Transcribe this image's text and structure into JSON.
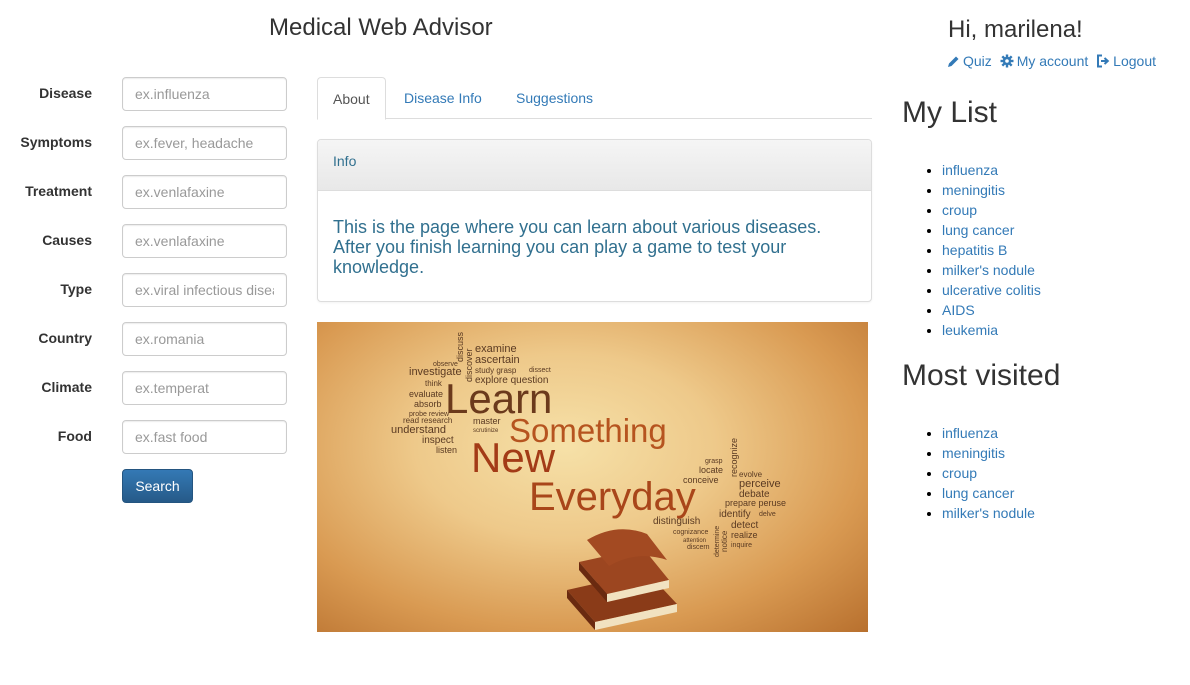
{
  "header": {
    "title": "Medical Web Advisor"
  },
  "user": {
    "greeting": "Hi, marilena!",
    "links": {
      "quiz": "Quiz",
      "account": "My account",
      "logout": "Logout"
    }
  },
  "search_form": {
    "fields": [
      {
        "label": "Disease",
        "placeholder": "ex.influenza"
      },
      {
        "label": "Symptoms",
        "placeholder": "ex.fever, headache"
      },
      {
        "label": "Treatment",
        "placeholder": "ex.venlafaxine"
      },
      {
        "label": "Causes",
        "placeholder": "ex.venlafaxine"
      },
      {
        "label": "Type",
        "placeholder": "ex.viral infectious disease"
      },
      {
        "label": "Country",
        "placeholder": "ex.romania"
      },
      {
        "label": "Climate",
        "placeholder": "ex.temperat"
      },
      {
        "label": "Food",
        "placeholder": "ex.fast food"
      }
    ],
    "submit_label": "Search"
  },
  "tabs": [
    {
      "label": "About",
      "active": true
    },
    {
      "label": "Disease Info",
      "active": false
    },
    {
      "label": "Suggestions",
      "active": false
    }
  ],
  "info_panel": {
    "heading": "Info",
    "body": "This is the page where you can learn about various diseases. After you finish learning you can play a game to test your knowledge."
  },
  "hero_image": {
    "words": {
      "learn": "Learn",
      "something": "Something",
      "new": "New",
      "everyday": "Everyday",
      "examine": "examine",
      "ascertain": "ascertain",
      "investigate": "investigate",
      "explore": "explore question",
      "study": "study grasp",
      "understand": "understand",
      "inspect": "inspect",
      "listen": "listen",
      "research": "read research",
      "master": "master",
      "evaluate": "evaluate",
      "absorb": "absorb",
      "think": "think",
      "observe": "observe",
      "probe": "probe review",
      "discuss": "discuss",
      "discover": "discover",
      "dissect": "dissect",
      "scrutinize": "scrutinize",
      "grasp": "grasp",
      "locate": "locate",
      "conceive": "conceive",
      "recognize": "recognize",
      "evolve": "evolve",
      "perceive": "perceive",
      "debate": "debate",
      "prepare": "prepare peruse",
      "identify": "identify",
      "delve": "delve",
      "distinguish": "distinguish",
      "detect": "detect",
      "realize": "realize",
      "inquire": "inquire",
      "cognizance": "cognizance",
      "attention": "attention",
      "discern": "discern",
      "determine": "determine",
      "notice": "notice"
    }
  },
  "my_list": {
    "title": "My List",
    "items": [
      "influenza",
      "meningitis",
      "croup",
      "lung cancer",
      "hepatitis B",
      "milker's nodule",
      "ulcerative colitis",
      "AIDS",
      "leukemia"
    ]
  },
  "most_visited": {
    "title": "Most visited",
    "items": [
      "influenza",
      "meningitis",
      "croup",
      "lung cancer",
      "milker's nodule"
    ]
  },
  "colors": {
    "link": "#337ab7",
    "primary_button": "#265a88",
    "info_text": "#31708f"
  }
}
